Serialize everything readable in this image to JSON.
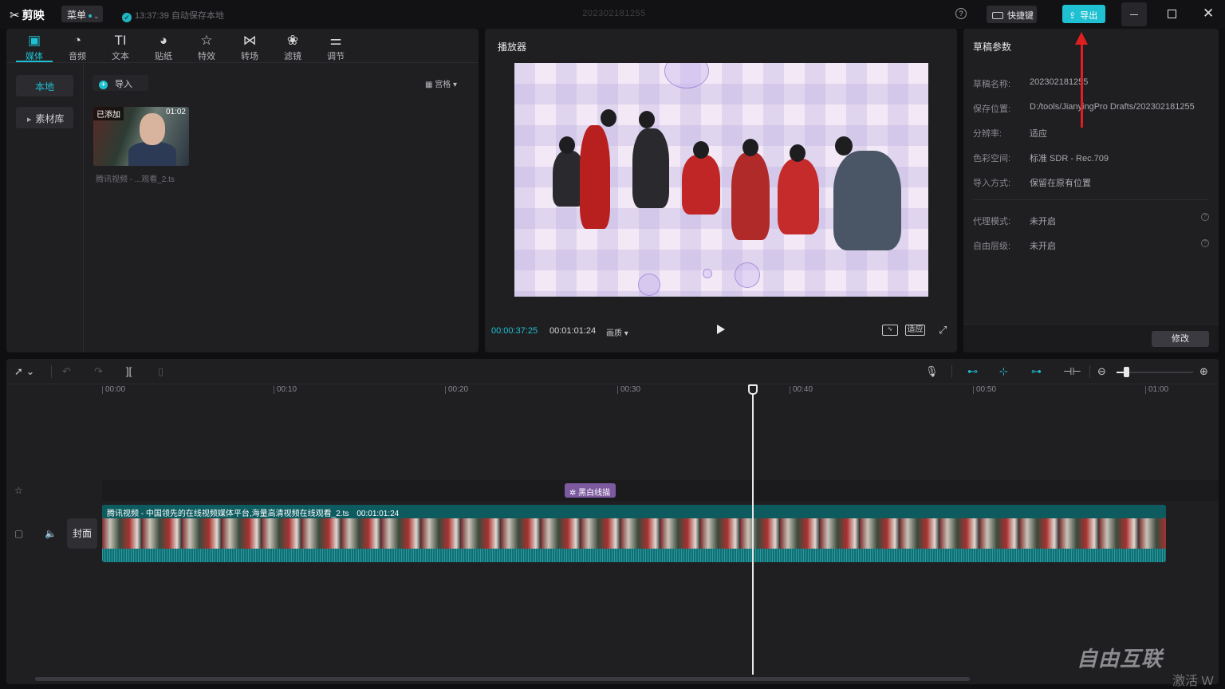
{
  "titlebar": {
    "app_name": "剪映",
    "menu_label": "菜单",
    "save_status": "13:37:39 自动保存本地",
    "draft_title": "202302181255",
    "shortcut_label": "快捷键",
    "export_label": "导出"
  },
  "media_panel": {
    "tabs": [
      {
        "label": "媒体",
        "icon": "media-icon"
      },
      {
        "label": "音频",
        "icon": "audio-icon"
      },
      {
        "label": "文本",
        "icon": "text-icon"
      },
      {
        "label": "贴纸",
        "icon": "sticker-icon"
      },
      {
        "label": "特效",
        "icon": "effects-icon"
      },
      {
        "label": "转场",
        "icon": "transition-icon"
      },
      {
        "label": "滤镜",
        "icon": "filter-icon"
      },
      {
        "label": "调节",
        "icon": "adjust-icon"
      }
    ],
    "active_tab": "媒体",
    "sidebar": {
      "local": "本地",
      "library": "素材库"
    },
    "import_label": "导入",
    "sort_label": "宫格",
    "item": {
      "badge": "已添加",
      "duration": "01:02",
      "name": "腾讯视频 - ...观看_2.ts"
    }
  },
  "player": {
    "title": "播放器",
    "current_time": "00:00:37:25",
    "total_time": "00:01:01:24",
    "quality_label": "画质",
    "fit_label": "适应"
  },
  "params": {
    "title": "草稿参数",
    "rows": [
      {
        "label": "草稿名称:",
        "value": "202302181255"
      },
      {
        "label": "保存位置:",
        "value": "D:/tools/JianyingPro Drafts/202302181255"
      },
      {
        "label": "分辨率:",
        "value": "适应"
      },
      {
        "label": "色彩空间:",
        "value": "标准 SDR - Rec.709"
      },
      {
        "label": "导入方式:",
        "value": "保留在原有位置"
      },
      {
        "label": "代理模式:",
        "value": "未开启"
      },
      {
        "label": "自由层级:",
        "value": "未开启"
      }
    ],
    "modify_label": "修改"
  },
  "timeline": {
    "ruler": [
      "00:00",
      "00:10",
      "00:20",
      "00:30",
      "00:40",
      "00:50",
      "01:00"
    ],
    "effect_clip_label": "黑白线描",
    "cover_label": "封面",
    "video_clip": {
      "title": "腾讯视频 - 中国领先的在线视频媒体平台,海量高清视频在线观看_2.ts",
      "duration": "00:01:01:24"
    }
  },
  "watermark": {
    "main": "自由互联",
    "sub": "激活 W"
  },
  "colors": {
    "accent": "#1fc0d1",
    "annotation": "#e02020",
    "effect_clip": "#7d5aa0"
  }
}
